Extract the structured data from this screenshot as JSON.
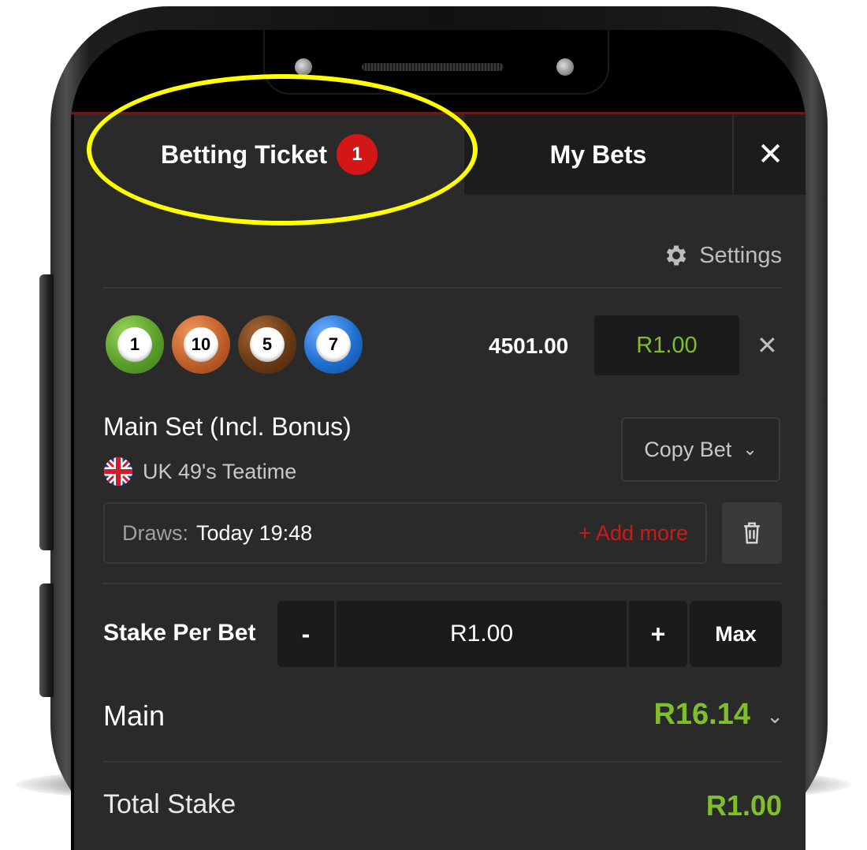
{
  "tabs": {
    "betting_ticket": "Betting Ticket",
    "betting_ticket_count": "1",
    "my_bets": "My Bets",
    "close": "✕"
  },
  "settings_label": "Settings",
  "selection": {
    "balls": [
      {
        "number": "1",
        "color": "#5aa02c"
      },
      {
        "number": "10",
        "color": "#c0602a"
      },
      {
        "number": "5",
        "color": "#6a3a14"
      },
      {
        "number": "7",
        "color": "#1f6fd0"
      }
    ],
    "odds": "4501.00",
    "stake": "R1.00",
    "remove": "✕"
  },
  "market": "Main Set (Incl. Bonus)",
  "event": "UK 49's Teatime",
  "copy_bet": "Copy Bet",
  "draws": {
    "label": "Draws:",
    "value": "Today 19:48",
    "add_more": "+ Add more"
  },
  "stake_per_bet": {
    "label": "Stake Per Bet",
    "minus": "-",
    "value": "R1.00",
    "plus": "+",
    "max": "Max"
  },
  "main": {
    "label": "Main",
    "value": "R16.14"
  },
  "total_stake": {
    "label": "Total Stake",
    "value": "R1.00"
  },
  "colors": {
    "accent_green": "#7fbf2a",
    "accent_red": "#d31717",
    "highlight": "#ffff00"
  }
}
